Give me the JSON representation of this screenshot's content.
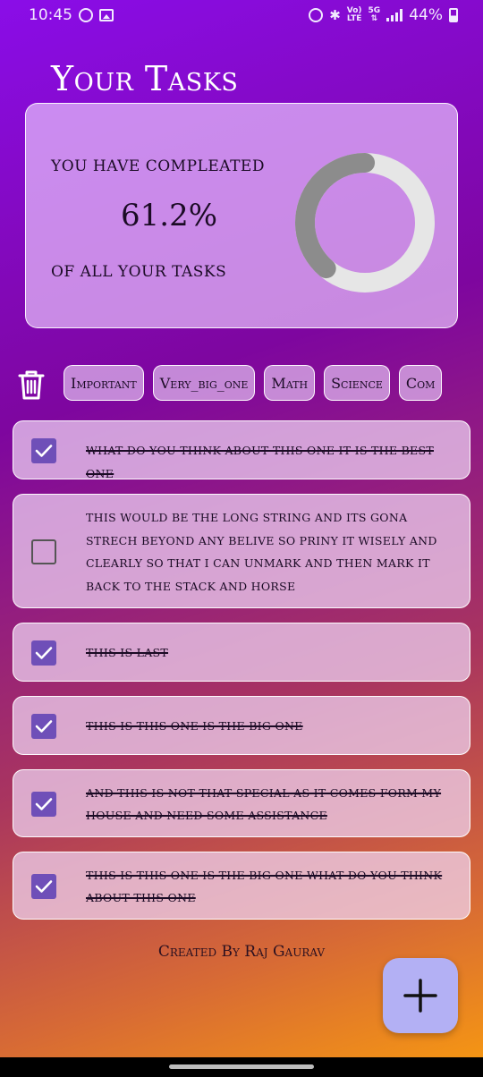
{
  "status_bar": {
    "time": "10:45",
    "network_top": "Vo)",
    "network_bottom": "LTE",
    "gen_top": "5G",
    "battery": "44%"
  },
  "header": {
    "title": "Your Tasks"
  },
  "summary": {
    "line_top": "YOU HAVE COMPLEATED",
    "percent": "61.2%",
    "line_bottom": "OF ALL YOUR TASKS",
    "progress_fraction": 0.612,
    "ring_color": "#e6e6e6",
    "ring_fill_color": "#8c8c8c"
  },
  "filters": {
    "chips": [
      "Important",
      "Very_big_one",
      "Math",
      "Science",
      "Com"
    ]
  },
  "tasks": [
    {
      "text": "what do you think about this one it is the best one",
      "done": true
    },
    {
      "text": "this would be the long string and its gona strech beyond any belive so priny it wisely and clearly so that i can unmark and then mark it back to the stack and horse",
      "done": false
    },
    {
      "text": "this is last",
      "done": true
    },
    {
      "text": "this is this one is the big one",
      "done": true
    },
    {
      "text": "and this is not that special as it comes form my house and need some assistance",
      "done": true
    },
    {
      "text": "this is this one is the big one what do you think about this one",
      "done": true
    }
  ],
  "footer": {
    "credit": "Created By Raj Gaurav"
  },
  "colors": {
    "accent": "#6f4fb8",
    "fab": "#b3b0f4"
  }
}
